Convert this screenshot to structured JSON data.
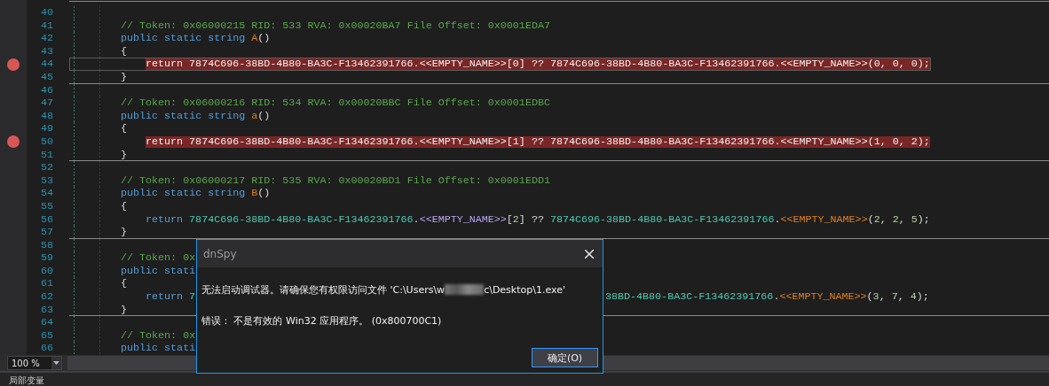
{
  "editor": {
    "lines": [
      {
        "number": "40"
      },
      {
        "number": "41",
        "kind": "member",
        "segments": [
          {
            "kind": "comment",
            "text": "// Token: 0x06000215 RID: 533 RVA: 0x00020BA7 File Offset: 0x0001EDA7"
          }
        ]
      },
      {
        "number": "42",
        "kind": "member",
        "segments": [
          {
            "kind": "keyword",
            "text": "public static string "
          },
          {
            "kind": "method",
            "text": "A"
          },
          {
            "kind": "plain",
            "text": "()"
          }
        ]
      },
      {
        "number": "43",
        "kind": "member",
        "segments": [
          {
            "kind": "plain",
            "text": "{"
          }
        ]
      },
      {
        "number": "44",
        "kind": "statement",
        "breakpoint": true,
        "current": true,
        "segments": [
          {
            "kind": "keyword",
            "text": "return "
          },
          {
            "kind": "type",
            "text": "7874C696-38BD-4B80-BA3C-F13462391766"
          },
          {
            "kind": "plain",
            "text": "."
          },
          {
            "kind": "field",
            "text": "<<EMPTY_NAME>>"
          },
          {
            "kind": "plain",
            "text": "["
          },
          {
            "kind": "number",
            "text": "0"
          },
          {
            "kind": "plain",
            "text": "] ?? "
          },
          {
            "kind": "type",
            "text": "7874C696-38BD-4B80-BA3C-F13462391766"
          },
          {
            "kind": "plain",
            "text": "."
          },
          {
            "kind": "method",
            "text": "<<EMPTY_NAME>>"
          },
          {
            "kind": "plain",
            "text": "(0, 0, 0);"
          }
        ]
      },
      {
        "number": "45",
        "kind": "member",
        "separator": true,
        "segments": [
          {
            "kind": "plain",
            "text": "}"
          }
        ]
      },
      {
        "number": "46"
      },
      {
        "number": "47",
        "kind": "member",
        "segments": [
          {
            "kind": "comment",
            "text": "// Token: 0x06000216 RID: 534 RVA: 0x00020BBC File Offset: 0x0001EDBC"
          }
        ]
      },
      {
        "number": "48",
        "kind": "member",
        "segments": [
          {
            "kind": "keyword",
            "text": "public static string "
          },
          {
            "kind": "method",
            "text": "a"
          },
          {
            "kind": "plain",
            "text": "()"
          }
        ]
      },
      {
        "number": "49",
        "kind": "member",
        "segments": [
          {
            "kind": "plain",
            "text": "{"
          }
        ]
      },
      {
        "number": "50",
        "kind": "statement",
        "breakpoint": true,
        "segments": [
          {
            "kind": "keyword",
            "text": "return "
          },
          {
            "kind": "type",
            "text": "7874C696-38BD-4B80-BA3C-F13462391766"
          },
          {
            "kind": "plain",
            "text": "."
          },
          {
            "kind": "field",
            "text": "<<EMPTY_NAME>>"
          },
          {
            "kind": "plain",
            "text": "["
          },
          {
            "kind": "number",
            "text": "1"
          },
          {
            "kind": "plain",
            "text": "] ?? "
          },
          {
            "kind": "type",
            "text": "7874C696-38BD-4B80-BA3C-F13462391766"
          },
          {
            "kind": "plain",
            "text": "."
          },
          {
            "kind": "method",
            "text": "<<EMPTY_NAME>>"
          },
          {
            "kind": "plain",
            "text": "(1, 0, 2);"
          }
        ]
      },
      {
        "number": "51",
        "kind": "member",
        "separator": true,
        "segments": [
          {
            "kind": "plain",
            "text": "}"
          }
        ]
      },
      {
        "number": "52"
      },
      {
        "number": "53",
        "kind": "member",
        "segments": [
          {
            "kind": "comment",
            "text": "// Token: 0x06000217 RID: 535 RVA: 0x00020BD1 File Offset: 0x0001EDD1"
          }
        ]
      },
      {
        "number": "54",
        "kind": "member",
        "segments": [
          {
            "kind": "keyword",
            "text": "public static string "
          },
          {
            "kind": "method",
            "text": "B"
          },
          {
            "kind": "plain",
            "text": "()"
          }
        ]
      },
      {
        "number": "55",
        "kind": "member",
        "segments": [
          {
            "kind": "plain",
            "text": "{"
          }
        ]
      },
      {
        "number": "56",
        "kind": "statement",
        "segments": [
          {
            "kind": "keyword",
            "text": "return "
          },
          {
            "kind": "type",
            "text": "7874C696-38BD-4B80-BA3C-F13462391766"
          },
          {
            "kind": "plain",
            "text": "."
          },
          {
            "kind": "field",
            "text": "<<EMPTY_NAME>>"
          },
          {
            "kind": "plain",
            "text": "["
          },
          {
            "kind": "number",
            "text": "2"
          },
          {
            "kind": "plain",
            "text": "] ?? "
          },
          {
            "kind": "type",
            "text": "7874C696-38BD-4B80-BA3C-F13462391766"
          },
          {
            "kind": "plain",
            "text": "."
          },
          {
            "kind": "method",
            "text": "<<EMPTY_NAME>>"
          },
          {
            "kind": "plain",
            "text": "("
          },
          {
            "kind": "number",
            "text": "2"
          },
          {
            "kind": "plain",
            "text": ", "
          },
          {
            "kind": "number",
            "text": "2"
          },
          {
            "kind": "plain",
            "text": ", "
          },
          {
            "kind": "number",
            "text": "5"
          },
          {
            "kind": "plain",
            "text": ");"
          }
        ]
      },
      {
        "number": "57",
        "kind": "member",
        "separator": true,
        "segments": [
          {
            "kind": "plain",
            "text": "}"
          }
        ]
      },
      {
        "number": "58"
      },
      {
        "number": "59",
        "kind": "member",
        "segments": [
          {
            "kind": "comment",
            "text": "// Token: 0x"
          }
        ]
      },
      {
        "number": "60",
        "kind": "member",
        "segments": [
          {
            "kind": "keyword",
            "text": "public stati"
          }
        ]
      },
      {
        "number": "61",
        "kind": "member",
        "segments": [
          {
            "kind": "plain",
            "text": "{"
          }
        ]
      },
      {
        "number": "62",
        "kind": "statement",
        "segments": [
          {
            "kind": "keyword",
            "text": "return "
          },
          {
            "kind": "type",
            "text": "7"
          }
        ],
        "segments_right_of_dialog": [
          {
            "kind": "type",
            "text": "38BD-4B80-BA3C-F13462391766"
          },
          {
            "kind": "plain",
            "text": "."
          },
          {
            "kind": "method",
            "text": "<<EMPTY_NAME>>"
          },
          {
            "kind": "plain",
            "text": "("
          },
          {
            "kind": "number",
            "text": "3"
          },
          {
            "kind": "plain",
            "text": ", "
          },
          {
            "kind": "number",
            "text": "7"
          },
          {
            "kind": "plain",
            "text": ", "
          },
          {
            "kind": "number",
            "text": "4"
          },
          {
            "kind": "plain",
            "text": ");"
          }
        ]
      },
      {
        "number": "63",
        "kind": "member",
        "separator": true,
        "segments": [
          {
            "kind": "plain",
            "text": "}"
          }
        ]
      },
      {
        "number": "64"
      },
      {
        "number": "65",
        "kind": "member",
        "segments": [
          {
            "kind": "comment",
            "text": "// Token: 0x"
          }
        ]
      },
      {
        "number": "66",
        "kind": "member",
        "segments": [
          {
            "kind": "keyword",
            "text": "public stati"
          }
        ]
      }
    ],
    "zoom": "100 %"
  },
  "dialog": {
    "title": "dnSpy",
    "message_start": "无法启动调试器。请确保您有权限访问文件 'C:\\Users\\w",
    "message_end": "c\\Desktop\\1.exe'",
    "error": "错误： 不是有效的 Win32 应用程序。 (0x800700C1)",
    "button": "确定(O)"
  },
  "bottom_panel": {
    "title": "局部变量"
  }
}
